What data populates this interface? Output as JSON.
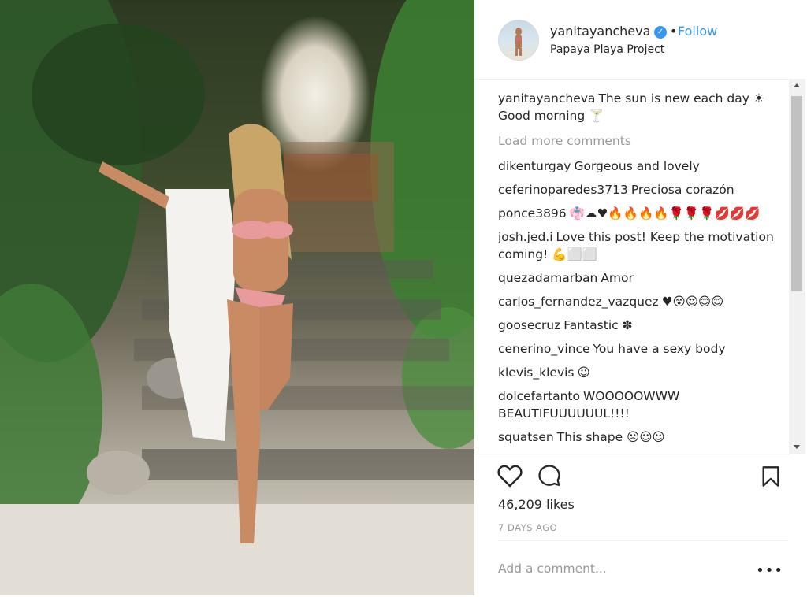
{
  "post": {
    "username": "yanitayancheva",
    "verified_icon": "verified-badge-icon",
    "separator": "•",
    "follow_label": "Follow",
    "location": "Papaya Playa Project",
    "caption_text": "The sun is new each day ☀ Good morning 🍸",
    "load_more_label": "Load more comments",
    "comments": [
      {
        "user": "dikenturgay",
        "text": "Gorgeous and lovely"
      },
      {
        "user": "ceferinoparedes3713",
        "text": "Preciosa corazón"
      },
      {
        "user": "ponce3896",
        "text": "👘☁♥🔥🔥🔥🔥🌹🌹🌹💋💋💋"
      },
      {
        "user": "josh.jed.i",
        "text": "Love this post! Keep the motivation coming! 💪⬜⬜"
      },
      {
        "user": "quezadamarban",
        "text": "Amor"
      },
      {
        "user": "carlos_fernandez_vazquez",
        "text": "♥😵😍😊😊"
      },
      {
        "user": "goosecruz",
        "text": "Fantastic ✽"
      },
      {
        "user": "cenerino_vince",
        "text": "You have a sexy body"
      },
      {
        "user": "klevis_klevis",
        "text": "☺"
      },
      {
        "user": "dolcefartanto",
        "text": "WOOOOOWWW BEAUTIFUUUUUUL!!!!"
      },
      {
        "user": "squatsen",
        "text": "This shape ☹☺☺"
      }
    ],
    "likes_label": "46,209 likes",
    "time_ago": "7 DAYS AGO",
    "add_comment_placeholder": "Add a comment...",
    "more_label": "•••"
  },
  "colors": {
    "link_blue": "#3897f0",
    "muted_gray": "#999999",
    "text": "#262626"
  }
}
